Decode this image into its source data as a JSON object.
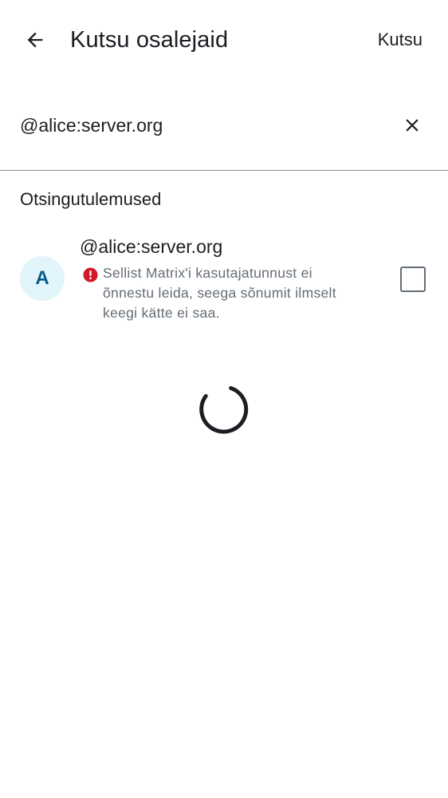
{
  "header": {
    "title": "Kutsu osalejaid",
    "action_label": "Kutsu",
    "back_icon": "arrow-left-icon"
  },
  "search": {
    "value": "@alice:server.org",
    "clear_icon": "close-icon"
  },
  "results": {
    "section_title": "Otsingutulemused",
    "items": [
      {
        "avatar_letter": "A",
        "name": "@alice:server.org",
        "warning": "Sellist Matrix'i kasutajatunnust ei õnnestu leida, seega sõnumit ilmselt keegi kätte ei saa.",
        "warning_icon": "error-icon",
        "checked": false
      }
    ]
  },
  "loading": {
    "icon": "loading-spinner-icon"
  },
  "colors": {
    "text_primary": "#1b1d22",
    "text_secondary": "#656d77",
    "error": "#d51928",
    "avatar_bg": "#e1f5fa",
    "avatar_fg": "#0b5a8c",
    "divider": "#8e9196"
  }
}
